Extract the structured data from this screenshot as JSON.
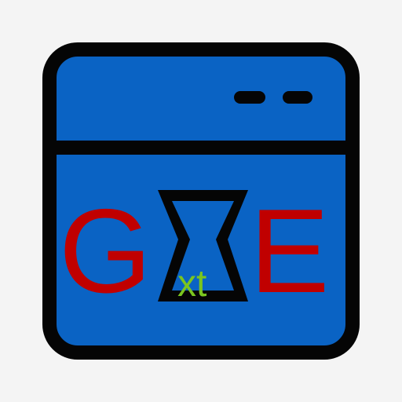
{
  "logo": {
    "letter_left": "G",
    "letter_right": "E",
    "hourglass_text": "xt",
    "colors": {
      "background": "#f4f4f4",
      "window_fill": "#0a63c4",
      "outline": "#050505",
      "letters": "#c00000",
      "hourglass_text": "#7ac51f"
    },
    "icons": [
      "app-window-icon",
      "hourglass-icon"
    ]
  }
}
